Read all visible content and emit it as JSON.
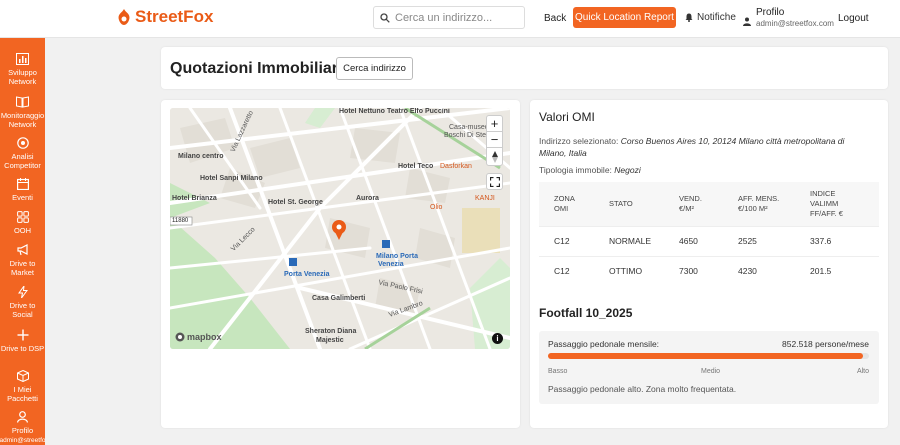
{
  "header": {
    "brand": "StreetFox",
    "search_placeholder": "Cerca un indirizzo...",
    "back": "Back",
    "quick_report": "Quick Location Report",
    "notifications": "Notifiche",
    "profile_label": "Profilo",
    "profile_email": "admin@streetfox.com",
    "logout": "Logout"
  },
  "sidebar": {
    "items": [
      {
        "label": "Sviluppo Network",
        "icon": "chart-bars-icon"
      },
      {
        "label": "Monitoraggio Network",
        "icon": "book-open-icon"
      },
      {
        "label": "Analisi Competitor",
        "icon": "target-icon"
      },
      {
        "label": "Eventi",
        "icon": "calendar-icon"
      },
      {
        "label": "OOH",
        "icon": "grid-icon"
      },
      {
        "label": "Drive to Market",
        "icon": "megaphone-icon"
      },
      {
        "label": "Drive to Social",
        "icon": "lightning-icon"
      },
      {
        "label": "Drive to DSP",
        "icon": "plus-icon"
      },
      {
        "label": "I Miei Pacchetti",
        "icon": "package-icon"
      },
      {
        "label": "Profilo",
        "icon": "user-icon"
      },
      {
        "label": "admin@streetfo",
        "icon": ""
      }
    ]
  },
  "page": {
    "title": "Quotazioni Immobiliari",
    "search_button": "Cerca indirizzo"
  },
  "map": {
    "attribution": "mapbox",
    "zoom_in": "+",
    "zoom_out": "−",
    "labels": {
      "hotel_nettuno": "Hotel Nettuno",
      "teatro": "Teatro Elfo Puccini",
      "casa_museo": "Casa-museo",
      "boschi": "Boschi Di Stef",
      "milano_centro": "Milano centro",
      "hotel_teco": "Hotel Teco",
      "dasforkan": "Dasforkan",
      "hotel_sanpi": "Hotel Sanpi Milano",
      "hotel_brianza": "Hotel Brianza",
      "hotel_st_george": "Hotel St. George",
      "aurora": "Aurora",
      "olio": "Olio",
      "kanji": "KANJI",
      "via_lazzaretto": "Via Lazzaretto",
      "via_lecco": "Via Lecco",
      "road_11880": "11880",
      "porta_venezia": "Porta Venezia",
      "milano_porta_venezia_1": "Milano Porta",
      "milano_porta_venezia_2": "Venezia",
      "via_paolo_frisi": "Via Paolo Frisi",
      "casa_galimberti": "Casa Galimberti",
      "via_lambro": "Via Lambro",
      "hotel_sheraton_1": "Sheraton Diana",
      "hotel_sheraton_2": "Majestic"
    }
  },
  "omi": {
    "title": "Valori OMI",
    "address_label": "Indirizzo selezionato:",
    "address_value": "Corso Buenos Aires 10, 20124 Milano città metropolitana di Milano, Italia",
    "type_label": "Tipologia immobile:",
    "type_value": "Negozi",
    "columns": [
      {
        "l1": "ZONA",
        "l2": "OMI"
      },
      {
        "l1": "STATO",
        "l2": ""
      },
      {
        "l1": "VEND.",
        "l2": "€/M²"
      },
      {
        "l1": "AFF. MENS.",
        "l2": "€/100 M²"
      },
      {
        "l1": "INDICE",
        "l2": "VALIMM",
        "l3": "FF/AFF. €"
      }
    ],
    "rows": [
      [
        "C12",
        "NORMALE",
        "4650",
        "2525",
        "337.6"
      ],
      [
        "C12",
        "OTTIMO",
        "7300",
        "4230",
        "201.5"
      ]
    ]
  },
  "footfall": {
    "title": "Footfall 10_2025",
    "label": "Passaggio pedonale mensile:",
    "value": "852.518 persone/mese",
    "level": 0.98,
    "scale_low": "Basso",
    "scale_mid": "Medio",
    "scale_high": "Alto",
    "note": "Passaggio pedonale alto. Zona molto frequentata.",
    "bar_color": "#f26522"
  },
  "colors": {
    "accent": "#f26522"
  }
}
